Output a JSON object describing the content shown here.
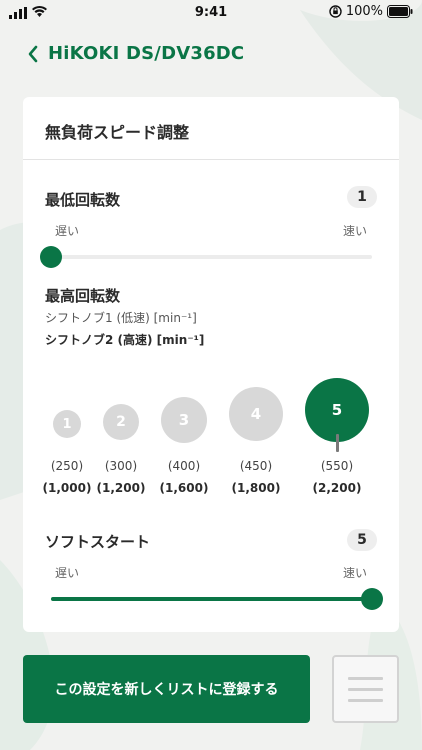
{
  "status_bar": {
    "time": "9:41",
    "battery": "100%"
  },
  "header": {
    "back_icon": "chevron-left-icon",
    "title": "HiKOKI DS/DV36DC"
  },
  "card": {
    "title": "無負荷スピード調整",
    "min_speed": {
      "label": "最低回転数",
      "value": "1",
      "slow_label": "遅い",
      "fast_label": "速い",
      "level": 0.0
    },
    "max_speed": {
      "label": "最高回転数",
      "sub1": "シフトノブ1 (低速) [min⁻¹]",
      "sub2": "シフトノブ2 (高速) [min⁻¹]",
      "selected": "5",
      "options": [
        {
          "level": "1",
          "low": "(250)",
          "high": "(1,000)"
        },
        {
          "level": "2",
          "low": "(300)",
          "high": "(1,200)"
        },
        {
          "level": "3",
          "low": "(400)",
          "high": "(1,600)"
        },
        {
          "level": "4",
          "low": "(450)",
          "high": "(1,800)"
        },
        {
          "level": "5",
          "low": "(550)",
          "high": "(2,200)"
        }
      ]
    },
    "soft_start": {
      "label": "ソフトスタート",
      "value": "5",
      "slow_label": "遅い",
      "fast_label": "速い",
      "level": 1.0
    }
  },
  "buttons": {
    "register": "この設定を新しくリストに登録する",
    "list_icon": "list-icon"
  },
  "colors": {
    "accent": "#0a7546",
    "inactive_circle": "#d8d8d8",
    "background": "#f1f2f0"
  }
}
